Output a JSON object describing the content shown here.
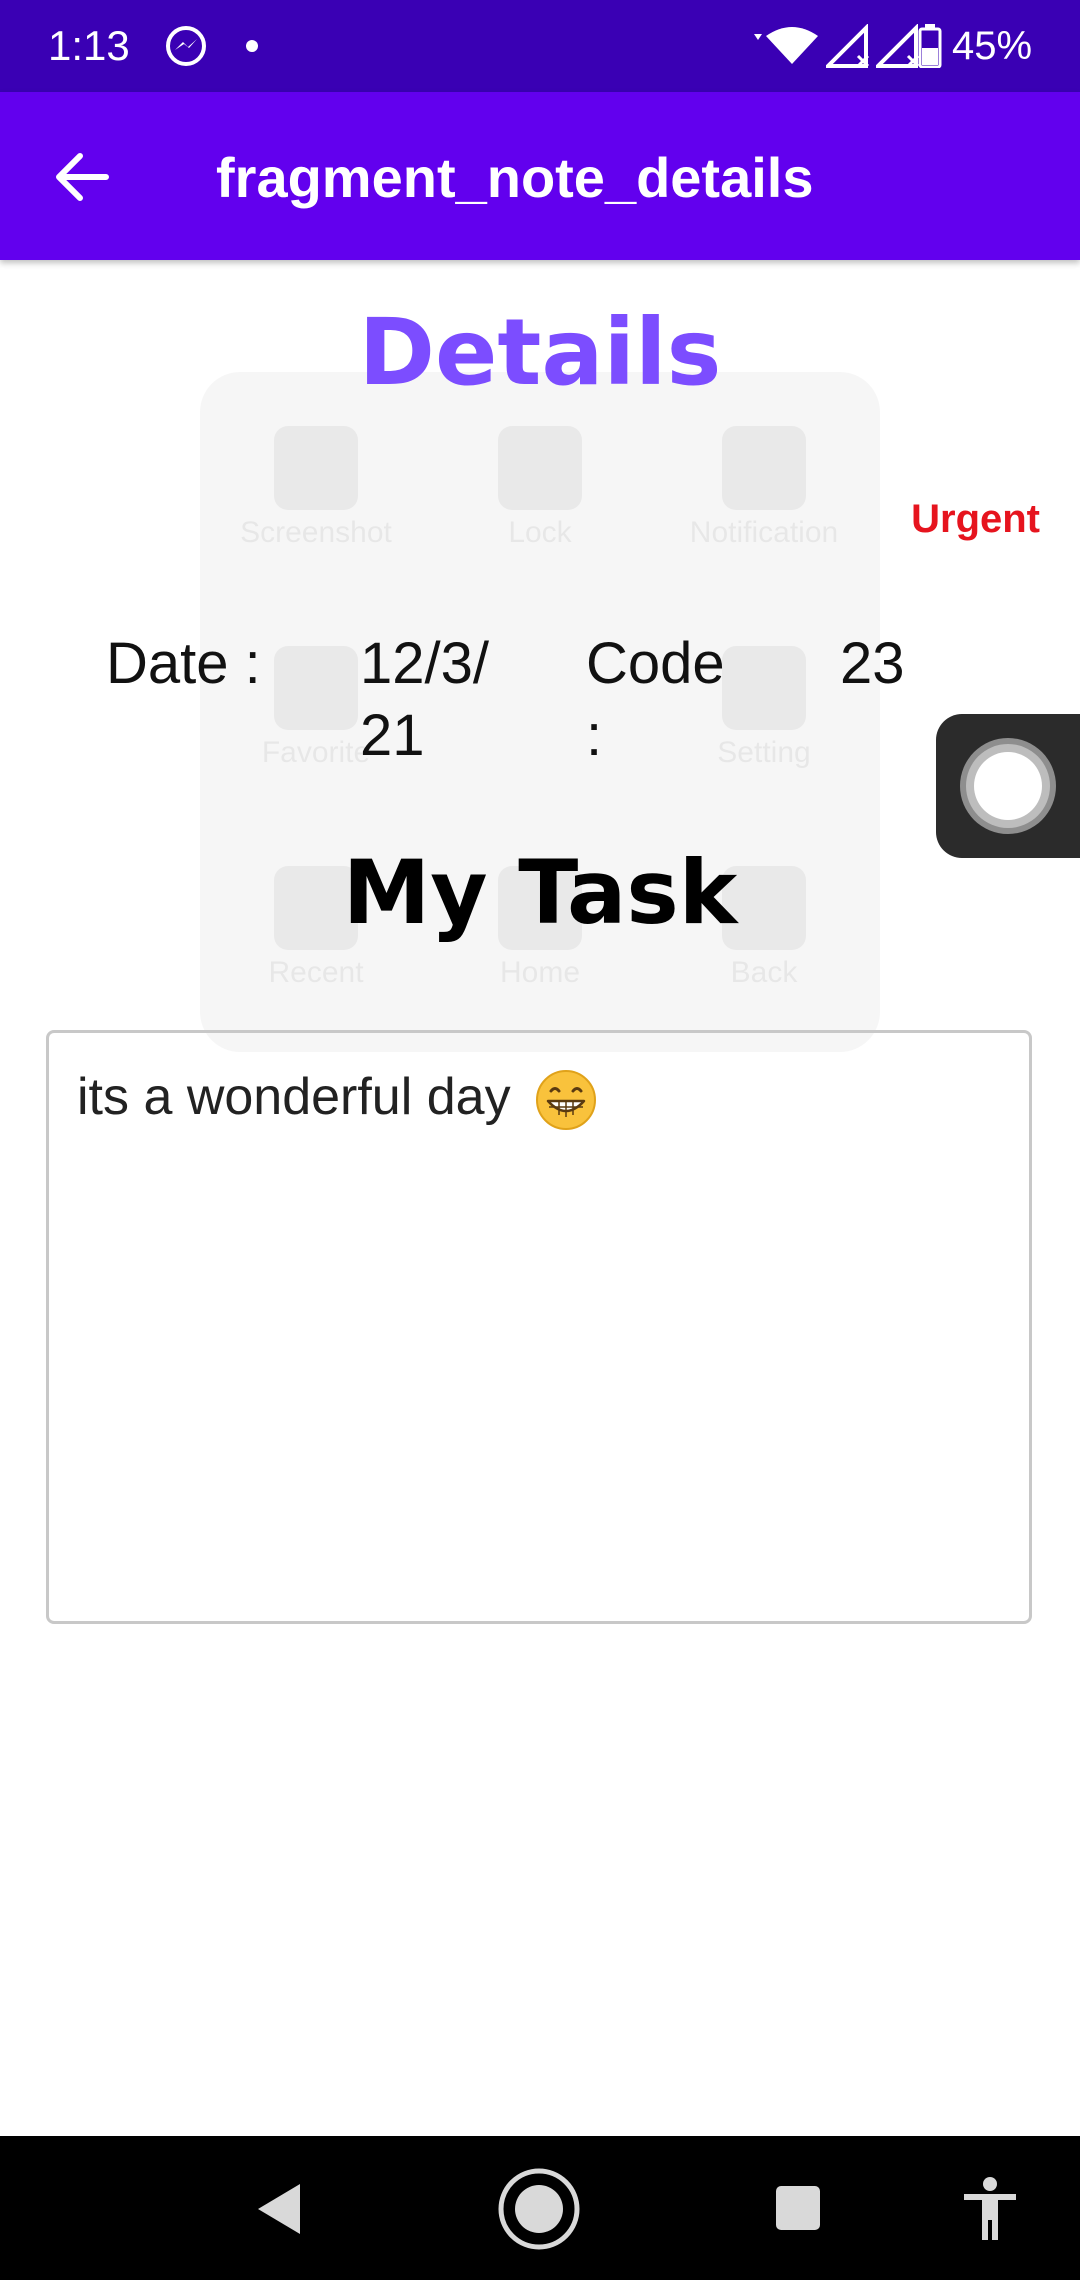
{
  "status_bar": {
    "time": "1:13",
    "battery": "45%",
    "icons": [
      "messenger-icon",
      "notification-dot",
      "wifi-icon",
      "signal-icon",
      "signal-icon",
      "battery-icon"
    ]
  },
  "app_bar": {
    "title": "fragment_note_details",
    "back_icon": "arrow-left-icon",
    "color": "#6200EE"
  },
  "details": {
    "heading": "Details",
    "priority": "Urgent",
    "date_label": "Date :",
    "date_value": "12/3/21",
    "code_label": "Code :",
    "code_value": "23",
    "task_title": "My Task",
    "note_text": "its a wonderful day"
  },
  "overlay": {
    "items": [
      "Screenshot",
      "Lock",
      "Notification",
      "Favorite",
      "",
      "Setting",
      "Recent",
      "Home",
      "Back"
    ]
  },
  "colors": {
    "status_bar": "#3A00B4",
    "accent": "#7C4DFF",
    "urgent": "#E6141E"
  },
  "nav_bar": {
    "icons": [
      "back-triangle-icon",
      "home-circle-icon",
      "recents-square-icon",
      "accessibility-icon"
    ]
  }
}
